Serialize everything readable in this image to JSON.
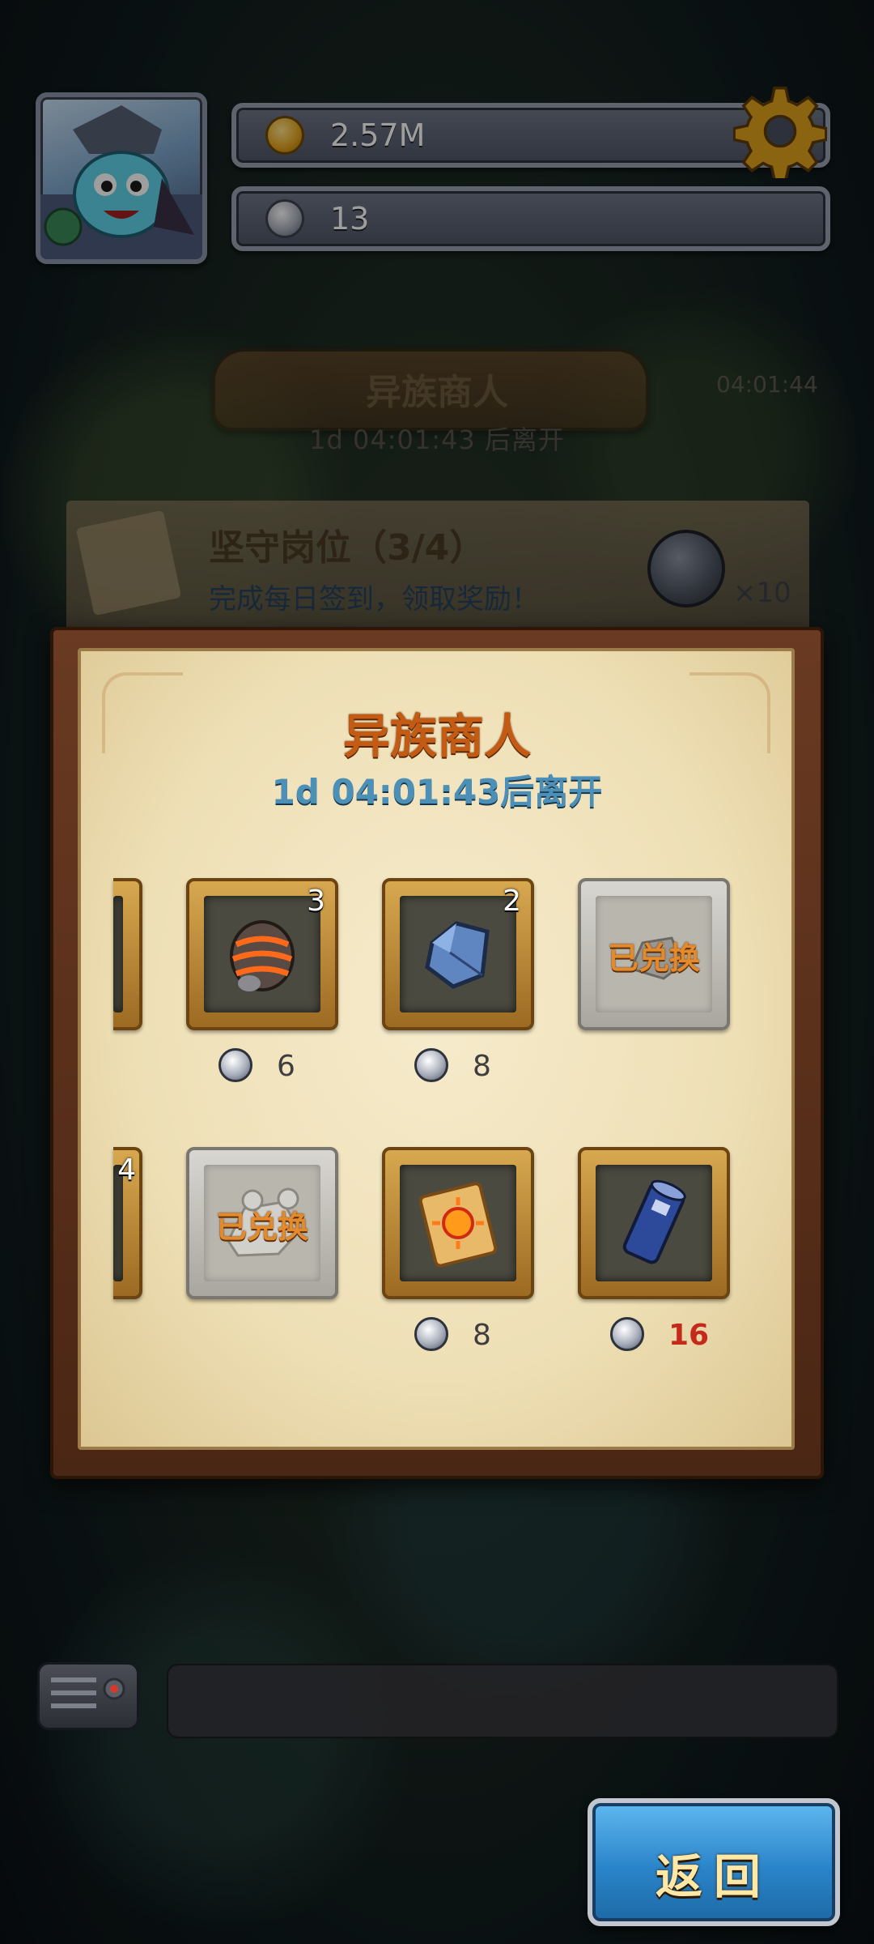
{
  "header": {
    "coins": "2.57M",
    "medals": "13"
  },
  "event_board": {
    "title": "异族商人",
    "timer": "1d 04:01:43 后离开",
    "side_timer": "04:01:44"
  },
  "quest": {
    "title": "坚守岗位（3/4）",
    "description": "完成每日签到，领取奖励！",
    "reward_count": "×10"
  },
  "shop": {
    "title": "异族商人",
    "timer": "1d 04:01:43后离开",
    "row1": [
      {
        "icon": "drill-bit-icon",
        "quantity": "3",
        "price": "6",
        "redeemed": false
      },
      {
        "icon": "blue-gem-icon",
        "quantity": "2",
        "price": "8",
        "redeemed": false
      },
      {
        "icon": "ore-icon",
        "status": "已兑换",
        "redeemed": true
      }
    ],
    "row2": [
      {
        "partial_quantity": "4"
      },
      {
        "icon": "bone-icon",
        "status": "已兑换",
        "redeemed": true
      },
      {
        "icon": "scroll-icon",
        "price": "8",
        "redeemed": false
      },
      {
        "icon": "blue-scroll-icon",
        "price": "16",
        "price_color": "#c42a1a",
        "redeemed": false
      }
    ]
  },
  "back_button": {
    "label": "返回"
  },
  "colors": {
    "panel_title": "#c45b12",
    "timer": "#4c90b8",
    "back_button": "#2a84c9",
    "unaffordable_price": "#c42a1a"
  }
}
